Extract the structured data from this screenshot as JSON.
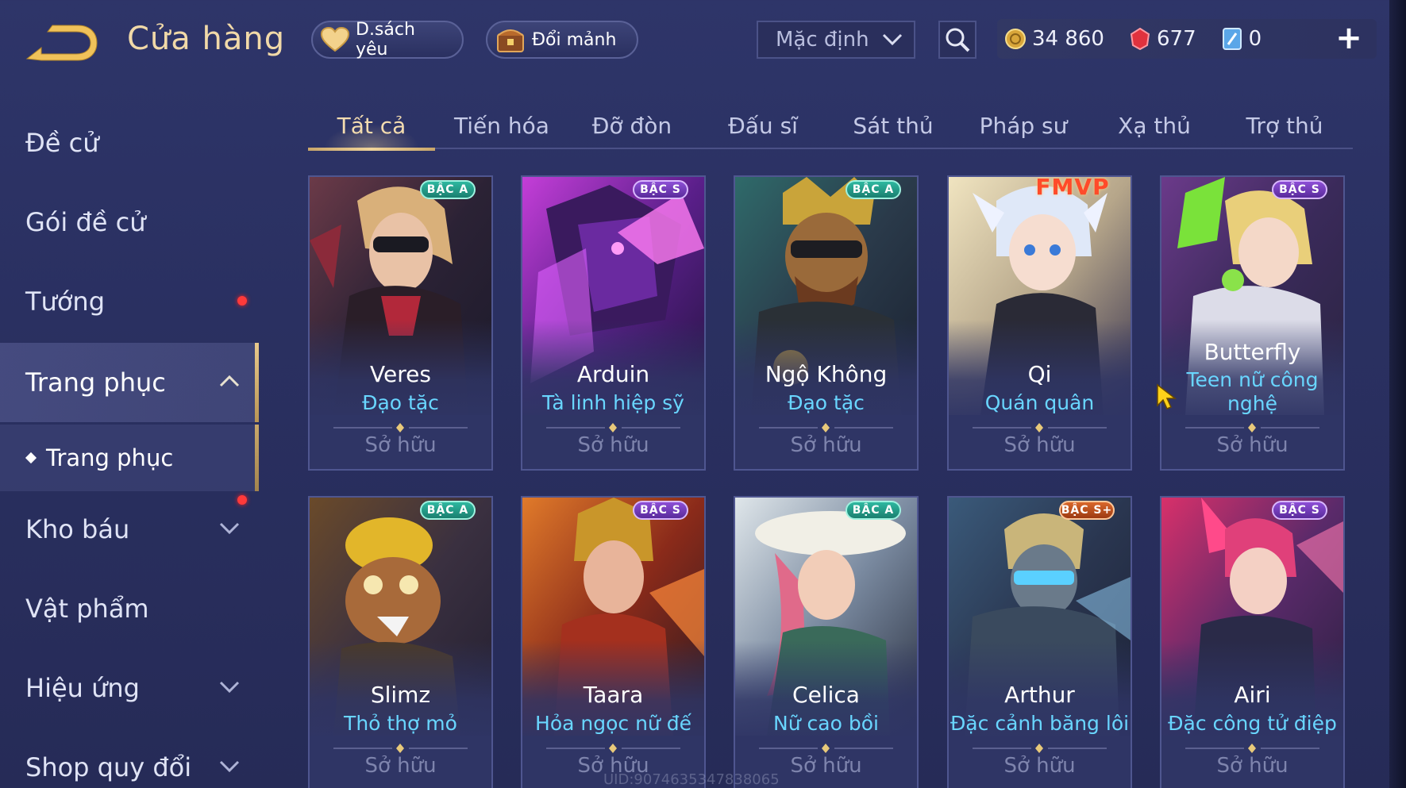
{
  "header": {
    "title": "Cửa hàng",
    "favorites_label": "D.sách yêu",
    "shards_label": "Đổi mảnh",
    "sort_value": "Mặc định",
    "currencies": {
      "gold": "34 860",
      "ruby": "677",
      "voucher": "0"
    }
  },
  "sidebar": {
    "items": [
      {
        "label": "Đề cử"
      },
      {
        "label": "Gói đề cử"
      },
      {
        "label": "Tướng"
      },
      {
        "label": "Trang phục"
      },
      {
        "label": "Kho báu"
      },
      {
        "label": "Vật phẩm"
      },
      {
        "label": "Hiệu ứng"
      },
      {
        "label": "Shop quy đổi"
      }
    ],
    "sub_item": "Trang phục"
  },
  "tabs": [
    "Tất cả",
    "Tiến hóa",
    "Đỡ đòn",
    "Đấu sĩ",
    "Sát thủ",
    "Pháp sư",
    "Xạ thủ",
    "Trợ thủ"
  ],
  "active_tab": "Tất cả",
  "cards": [
    {
      "hero": "Veres",
      "skin": "Đạo tặc",
      "tier": "BẬC A",
      "status": "Sở hữu"
    },
    {
      "hero": "Arduin",
      "skin": "Tà linh hiệp sỹ",
      "tier": "BẬC S",
      "status": "Sở hữu"
    },
    {
      "hero": "Ngộ Không",
      "skin": "Đạo tặc",
      "tier": "BẬC A",
      "status": "Sở hữu"
    },
    {
      "hero": "Qi",
      "skin": "Quán quân",
      "tier": "FMVP",
      "status": "Sở hữu"
    },
    {
      "hero": "Butterfly",
      "skin": "Teen nữ công nghệ",
      "tier": "BẬC S",
      "status": "Sở hữu"
    },
    {
      "hero": "Slimz",
      "skin": "Thỏ thợ mỏ",
      "tier": "BẬC A",
      "status": "Sở hữu"
    },
    {
      "hero": "Taara",
      "skin": "Hỏa ngọc nữ đế",
      "tier": "BẬC S",
      "status": "Sở hữu"
    },
    {
      "hero": "Celica",
      "skin": "Nữ cao bồi",
      "tier": "BẬC A",
      "status": "Sở hữu"
    },
    {
      "hero": "Arthur",
      "skin": "Đặc cảnh băng lôi",
      "tier": "BẬC S+",
      "status": "Sở hữu"
    },
    {
      "hero": "Airi",
      "skin": "Đặc công tử điệp",
      "tier": "BẬC S",
      "status": "Sở hữu"
    }
  ],
  "watermark": "UID:9074635347838065",
  "colors": {
    "accent_gold": "#f1d9a8",
    "skin_name": "#69d6ff",
    "notification": "#ff3a3a"
  }
}
